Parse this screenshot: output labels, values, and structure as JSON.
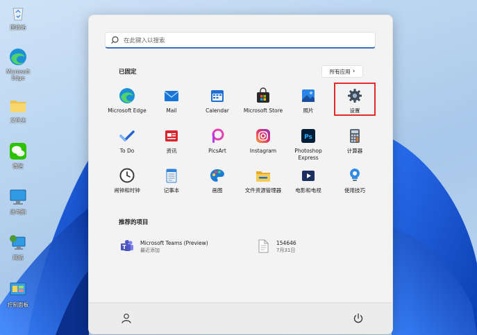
{
  "desktop": {
    "icons": [
      {
        "label": "回收站",
        "icon": "recycle-bin-icon"
      },
      {
        "label": "Microsoft Edge",
        "icon": "edge-icon"
      },
      {
        "label": "文件夹",
        "icon": "folder-icon"
      },
      {
        "label": "微信",
        "icon": "wechat-icon"
      },
      {
        "label": "此电脑",
        "icon": "computer-icon"
      },
      {
        "label": "网络",
        "icon": "network-icon"
      },
      {
        "label": "控制面板",
        "icon": "control-panel-icon"
      }
    ]
  },
  "start_menu": {
    "search_placeholder": "在此键入以搜索",
    "pinned_title": "已固定",
    "all_apps_label": "所有应用",
    "pinned_apps": [
      {
        "label": "Microsoft Edge",
        "icon": "edge-icon"
      },
      {
        "label": "Mail",
        "icon": "mail-icon"
      },
      {
        "label": "Calendar",
        "icon": "calendar-icon"
      },
      {
        "label": "Microsoft Store",
        "icon": "store-icon"
      },
      {
        "label": "照片",
        "icon": "photos-icon"
      },
      {
        "label": "设置",
        "icon": "settings-icon"
      },
      {
        "label": "To Do",
        "icon": "todo-icon"
      },
      {
        "label": "资讯",
        "icon": "news-icon"
      },
      {
        "label": "PicsArt",
        "icon": "picsart-icon"
      },
      {
        "label": "Instagram",
        "icon": "instagram-icon"
      },
      {
        "label": "Photoshop Express",
        "icon": "photoshop-icon"
      },
      {
        "label": "计算器",
        "icon": "calculator-icon"
      },
      {
        "label": "闹钟和时钟",
        "icon": "clock-icon"
      },
      {
        "label": "记事本",
        "icon": "notepad-icon"
      },
      {
        "label": "画图",
        "icon": "paint-icon"
      },
      {
        "label": "文件资源管理器",
        "icon": "file-explorer-icon"
      },
      {
        "label": "电影和电视",
        "icon": "movies-icon"
      },
      {
        "label": "使用技巧",
        "icon": "tips-icon"
      }
    ],
    "recommended_title": "推荐的项目",
    "recommended": [
      {
        "name": "Microsoft Teams (Preview)",
        "sub": "最近添加",
        "icon": "teams-icon"
      },
      {
        "name": "154646",
        "sub": "7月31日",
        "icon": "document-icon"
      }
    ],
    "accent": "#3b6fc4",
    "highlight_color": "#e22a2a"
  }
}
